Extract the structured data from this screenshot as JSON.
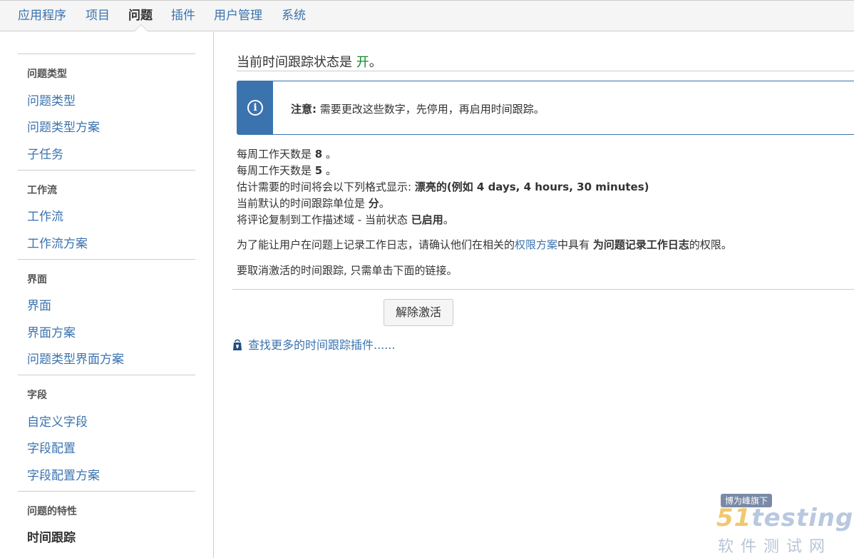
{
  "topnav": {
    "tabs": [
      "应用程序",
      "项目",
      "问题",
      "插件",
      "用户管理",
      "系统"
    ],
    "active_tab": "问题"
  },
  "sidebar": {
    "sections": [
      {
        "heading": "问题类型",
        "items": [
          "问题类型",
          "问题类型方案",
          "子任务"
        ]
      },
      {
        "heading": "工作流",
        "items": [
          "工作流",
          "工作流方案"
        ]
      },
      {
        "heading": "界面",
        "items": [
          "界面",
          "界面方案",
          "问题类型界面方案"
        ]
      },
      {
        "heading": "字段",
        "items": [
          "自定义字段",
          "字段配置",
          "字段配置方案"
        ]
      },
      {
        "heading": "问题的特性",
        "items": [
          "时间跟踪"
        ]
      }
    ],
    "current_item": "时间跟踪"
  },
  "main": {
    "status_prefix": "当前时间跟踪状态是 ",
    "status_value": "开",
    "status_suffix": "。",
    "notice": {
      "label": "注意:",
      "text": " 需要更改这些数字，先停用，再启用时间跟踪。"
    },
    "settings": [
      {
        "prefix": "每周工作天数是 ",
        "value": "8",
        "suffix": " 。"
      },
      {
        "prefix": "每周工作天数是 ",
        "value": "5",
        "suffix": " 。"
      },
      {
        "prefix": "估计需要的时间将会以下列格式显示: ",
        "value": "漂亮的(例如 4 days, 4 hours, 30 minutes)",
        "suffix": ""
      },
      {
        "prefix": "当前默认的时间跟踪单位是 ",
        "value": "分",
        "suffix": "。"
      },
      {
        "prefix": "将评论复制到工作描述域 - 当前状态 ",
        "value": "已启用",
        "suffix": "。"
      }
    ],
    "permission_note": {
      "prefix": "为了能让用户在问题上记录工作日志，请确认他们在相关的",
      "link": "权限方案",
      "middle": "中具有 ",
      "bold": "为问题记录工作日志",
      "suffix": "的权限。"
    },
    "deactivate_note": "要取消激活的时间跟踪, 只需单击下面的链接。",
    "deactivate_button": "解除激活",
    "plugin_link": "查找更多的时间跟踪插件......"
  },
  "watermark": {
    "badge": "博为峰旗下",
    "logo_num": "51",
    "logo_text": "testing",
    "sub": "软件测试网"
  },
  "colors": {
    "link": "#3b73af",
    "status_on": "#14892c",
    "notice_bar": "#3b73af"
  }
}
